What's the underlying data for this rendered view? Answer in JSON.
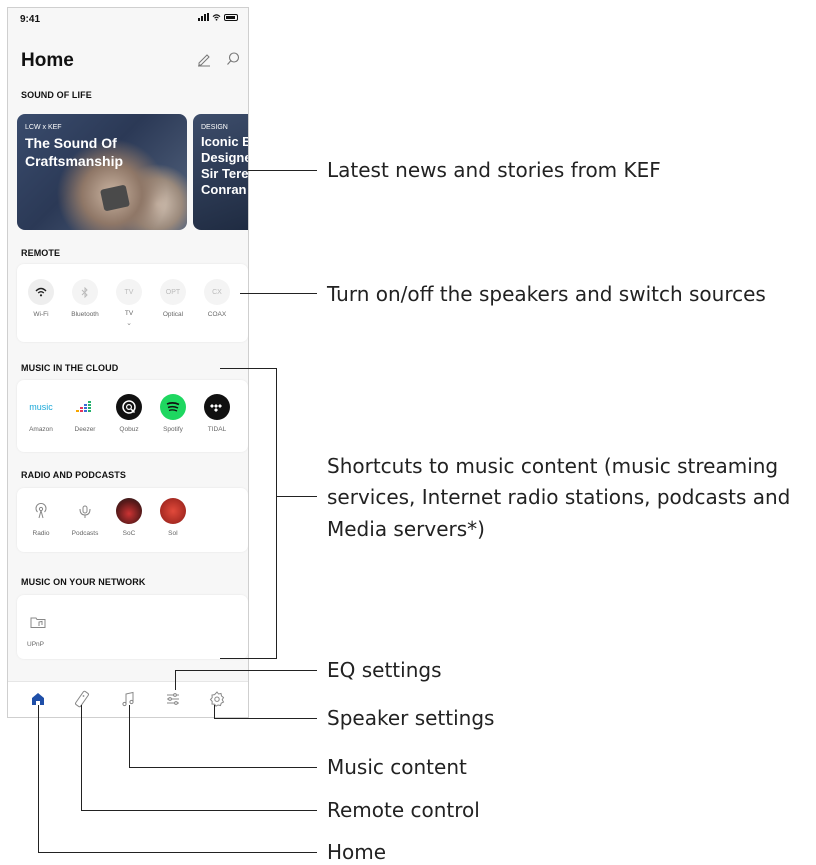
{
  "status": {
    "time": "9:41"
  },
  "header": {
    "title": "Home",
    "edit_icon": "pencil-icon",
    "search_icon": "search-icon"
  },
  "sound_of_life": {
    "label": "SOUND OF LIFE",
    "stories": [
      {
        "tag": "LCW x KEF",
        "headline": "The Sound Of Craftsmanship"
      },
      {
        "tag": "DESIGN",
        "headline": "Iconic B Designe Sir Tere Conran"
      }
    ]
  },
  "remote": {
    "label": "REMOTE",
    "items": [
      {
        "label": "Wi-Fi",
        "icon": "wifi-icon"
      },
      {
        "label": "Bluetooth",
        "icon": "bluetooth-icon"
      },
      {
        "label": "TV",
        "glyph": "TV"
      },
      {
        "label": "Optical",
        "glyph": "OPT"
      },
      {
        "label": "COAX",
        "glyph": "CX"
      }
    ]
  },
  "cloud": {
    "label": "MUSIC IN THE CLOUD",
    "items": [
      {
        "label": "Amazon",
        "glyph": "music"
      },
      {
        "label": "Deezer"
      },
      {
        "label": "Qobuz"
      },
      {
        "label": "Spotify"
      },
      {
        "label": "TIDAL"
      }
    ]
  },
  "radio": {
    "label": "RADIO AND PODCASTS",
    "items": [
      {
        "label": "Radio"
      },
      {
        "label": "Podcasts"
      },
      {
        "label": "SoC"
      },
      {
        "label": "SoI"
      }
    ]
  },
  "network": {
    "label": "MUSIC ON YOUR NETWORK",
    "items": [
      {
        "label": "UPnP"
      }
    ]
  },
  "tabs": [
    {
      "name": "home",
      "icon": "home-icon"
    },
    {
      "name": "remote",
      "icon": "remote-icon"
    },
    {
      "name": "music",
      "icon": "music-note-icon"
    },
    {
      "name": "eq",
      "icon": "sliders-icon"
    },
    {
      "name": "settings",
      "icon": "gear-icon"
    }
  ],
  "annotations": {
    "news": "Latest news and stories from KEF",
    "remote": "Turn on/off the speakers and switch sources",
    "shortcuts_1": "Shortcuts to music content (music streaming",
    "shortcuts_2": "services, Internet radio stations, podcasts and",
    "shortcuts_3": "Media servers*)",
    "eq": "EQ settings",
    "speaker": "Speaker settings",
    "music": "Music content",
    "remote_control": "Remote control",
    "home": "Home"
  },
  "colors": {
    "accent": "#1f4fa8",
    "spotify": "#1ed760",
    "line": "#222222"
  }
}
